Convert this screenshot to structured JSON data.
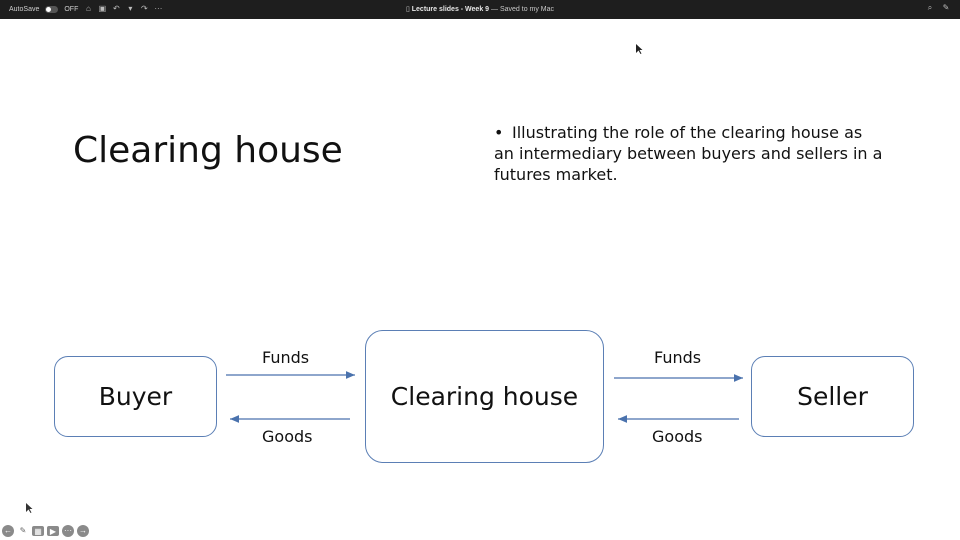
{
  "titlebar": {
    "autosave_label": "AutoSave",
    "autosave_state": "OFF",
    "document_title": "Lecture slides - Week 9",
    "save_status": "— Saved to my Mac"
  },
  "slide": {
    "title": "Clearing house",
    "bullet": "Illustrating the role of the clearing house as an intermediary between buyers and sellers in a futures market.",
    "diagram": {
      "buyer": "Buyer",
      "clearing_house": "Clearing house",
      "seller": "Seller",
      "funds_left": "Funds",
      "goods_left": "Goods",
      "funds_right": "Funds",
      "goods_right": "Goods"
    }
  },
  "icons": {
    "home": "home-icon",
    "save": "save-icon",
    "undo": "undo-icon",
    "redo": "redo-icon",
    "more": "more-icon",
    "search": "search-icon",
    "share": "share-icon"
  }
}
